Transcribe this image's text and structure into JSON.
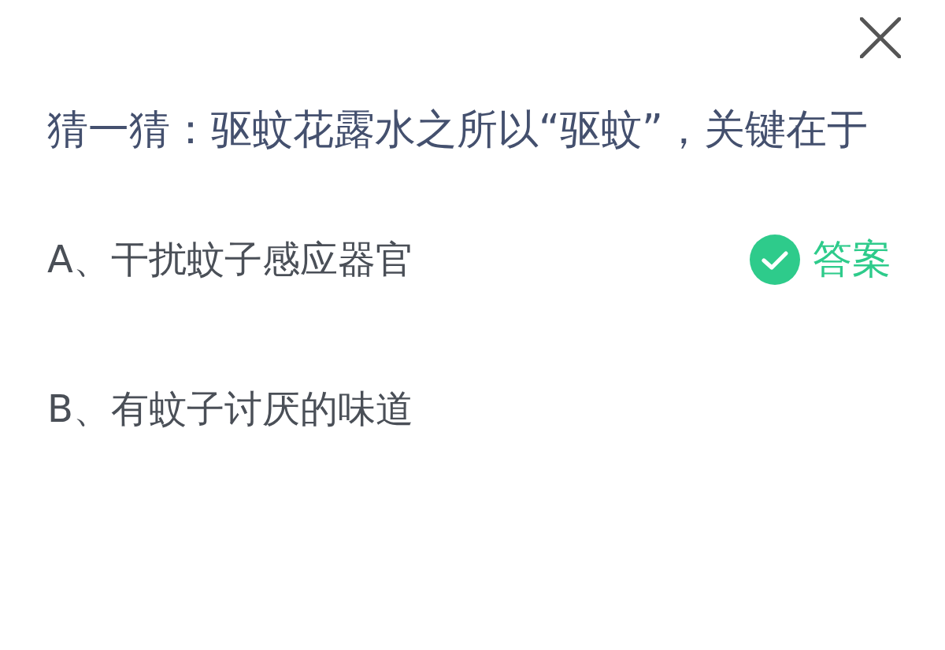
{
  "question": "猜一猜：驱蚊花露水之所以“驱蚊”，关键在于",
  "options": [
    {
      "text": "A、干扰蚊子感应器官",
      "correct": true,
      "answer_label": "答案"
    },
    {
      "text": "B、有蚊子讨厌的味道",
      "correct": false
    }
  ]
}
